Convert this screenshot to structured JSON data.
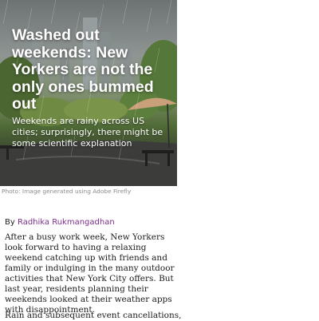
{
  "article": {
    "hero": {
      "title": "Washed out weekends: New Yorkers are not the only ones bummed out",
      "subtitle": "Weekends are rainy across US cities; surprisingly, there might be some scientific explanation",
      "image_description": "rainy city park with skyline and umbrella"
    },
    "photo_credit": "Photo: Image generated using Adobe Firefly",
    "byline": {
      "prefix": "By ",
      "author": "Radhika Rukmangadhan"
    },
    "paragraphs": [
      "After a busy work week, New Yorkers look forward to having a relaxing weekend catching up with friends and family or indulging in the many outdoor activities that New York City offers. But last year, residents planning their weekends looked at their weather apps with disappointment.",
      "Rain and subsequent event cancellations,"
    ]
  },
  "colors": {
    "author_link": "#7b2d8b",
    "body_text": "#1a1a1a",
    "credit_text": "#8a8a8a"
  }
}
